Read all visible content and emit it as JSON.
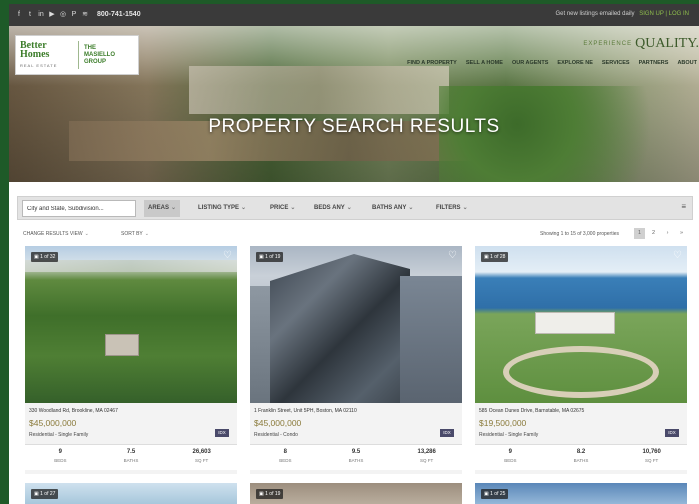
{
  "topbar": {
    "social_icons": [
      "facebook-icon",
      "twitter-icon",
      "linkedin-icon",
      "youtube-icon",
      "instagram-icon",
      "pinterest-icon",
      "rss-icon"
    ],
    "social_glyphs": [
      "f",
      "t",
      "in",
      "▶",
      "◎",
      "P",
      "≋"
    ],
    "phone": "800-741-1540",
    "right_text": "Get new listings emailed daily",
    "right_link": "SIGN UP | LOG IN"
  },
  "brand": {
    "logo_line1": "Better",
    "logo_line2": "Homes",
    "logo_line3": "REAL ESTATE",
    "group_line1": "THE",
    "group_line2": "MASIELLO",
    "group_line3": "GROUP",
    "tagline_small": "EXPERIENCE",
    "tagline": "QUALITY.",
    "accent_color": "#3c7d2a"
  },
  "nav": [
    "FIND A PROPERTY",
    "SELL A HOME",
    "OUR AGENTS",
    "EXPLORE NE",
    "SERVICES",
    "PARTNERS",
    "ABOUT"
  ],
  "hero": {
    "title": "PROPERTY SEARCH RESULTS"
  },
  "filters": {
    "search_value": "City and State, Subdivision...",
    "buttons": [
      "AREAS",
      "LISTING TYPE",
      "PRICE",
      "BEDS ANY",
      "BATHS ANY",
      "FILTERS"
    ],
    "menu_icon": "menu-icon"
  },
  "results": {
    "view_label": "CHANGE RESULTS VIEW",
    "sort_label": "SORT BY",
    "count_text": "Showing 1 to 15 of 3,000 properties",
    "pages": [
      "1",
      "2",
      "›",
      "»"
    ]
  },
  "listings": [
    {
      "photos": "1 of 32",
      "address": "330 Woodland Rd, Brookline, MA 02467",
      "price": "$45,000,000",
      "type": "Residential - Single Family",
      "idx": "IDX",
      "beds": "9",
      "baths": "7.5",
      "sqft": "26,603"
    },
    {
      "photos": "1 of 19",
      "address": "1 Franklin Street, Unit 5PH, Boston, MA 02110",
      "price": "$45,000,000",
      "type": "Residential - Condo",
      "idx": "IDX",
      "beds": "8",
      "baths": "9.5",
      "sqft": "13,286"
    },
    {
      "photos": "1 of 28",
      "address": "585 Ocean Dunes Drive, Barnstable, MA 02675",
      "price": "$19,500,000",
      "type": "Residential - Single Family",
      "idx": "IDX",
      "beds": "9",
      "baths": "8.2",
      "sqft": "10,760"
    }
  ],
  "stat_labels": {
    "beds": "BEDS",
    "baths": "BATHS",
    "sqft": "SQ FT"
  },
  "peek_badges": [
    "1 of 27",
    "1 of 19",
    "1 of 25"
  ]
}
